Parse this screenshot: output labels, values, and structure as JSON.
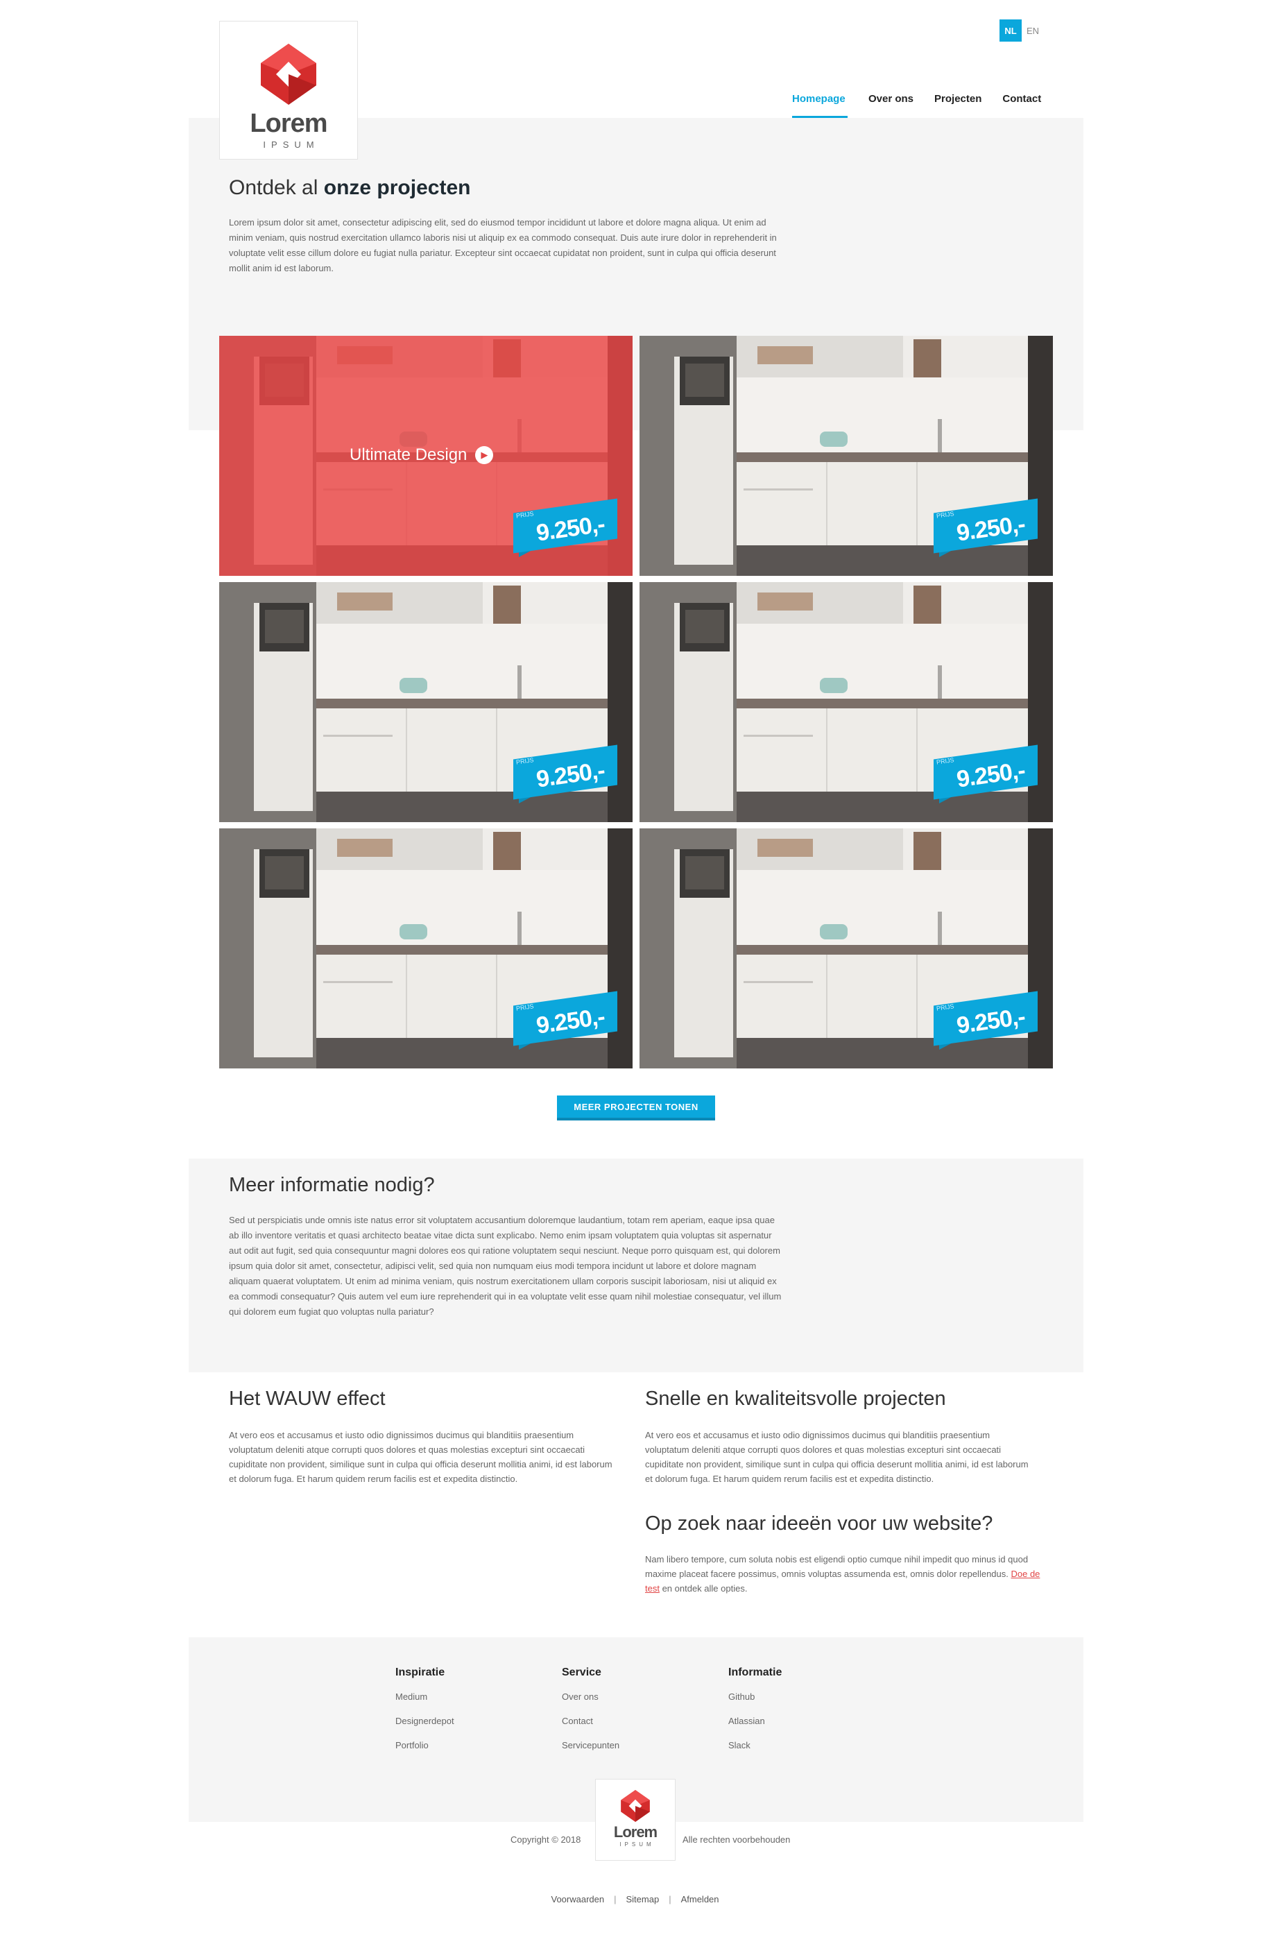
{
  "brand": {
    "name": "Lorem",
    "tagline": "IPSUM",
    "accent": "#0ba7dc",
    "logo_color": "#e53b3b"
  },
  "language": {
    "active": "NL",
    "other": "EN"
  },
  "nav": [
    {
      "label": "Homepage",
      "active": true
    },
    {
      "label": "Over ons",
      "active": false
    },
    {
      "label": "Projecten",
      "active": false
    },
    {
      "label": "Contact",
      "active": false
    }
  ],
  "hero": {
    "title_light": "Ontdek al ",
    "title_bold": "onze projecten",
    "text": "Lorem ipsum dolor sit amet, consectetur adipiscing elit, sed do eiusmod tempor incididunt ut labore et dolore magna aliqua. Ut enim ad minim veniam, quis nostrud exercitation ullamco laboris nisi ut aliquip ex ea commodo consequat. Duis aute irure dolor in reprehenderit in voluptate velit esse cillum dolore eu fugiat nulla pariatur. Excepteur sint occaecat cupidatat non proident, sunt in culpa qui officia deserunt mollit anim id est laborum."
  },
  "projects": {
    "overlay_label": "Ultimate Design",
    "overlay_color": "#ec4646",
    "items": [
      {
        "price_label": "PRIJS",
        "price": "9.250,-"
      },
      {
        "price_label": "PRIJS",
        "price": "9.250,-"
      },
      {
        "price_label": "PRIJS",
        "price": "9.250,-"
      },
      {
        "price_label": "PRIJS",
        "price": "9.250,-"
      },
      {
        "price_label": "PRIJS",
        "price": "9.250,-"
      },
      {
        "price_label": "PRIJS",
        "price": "9.250,-"
      }
    ],
    "more_button": "MEER PROJECTEN TONEN"
  },
  "info": {
    "title": "Meer informatie nodig?",
    "text": "Sed ut perspiciatis unde omnis iste natus error sit voluptatem accusantium doloremque laudantium, totam rem aperiam, eaque ipsa quae ab illo inventore veritatis et quasi architecto beatae vitae dicta sunt explicabo. Nemo enim ipsam voluptatem quia voluptas sit aspernatur aut odit aut fugit, sed quia consequuntur magni dolores eos qui ratione voluptatem sequi nesciunt. Neque porro quisquam est, qui dolorem ipsum quia dolor sit amet, consectetur, adipisci velit, sed quia non numquam eius modi tempora incidunt ut labore et dolore magnam aliquam quaerat voluptatem. Ut enim ad minima veniam, quis nostrum exercitationem ullam corporis suscipit laboriosam, nisi ut aliquid ex ea commodi consequatur? Quis autem vel eum iure reprehenderit qui in ea voluptate velit esse quam nihil molestiae consequatur, vel illum qui dolorem eum fugiat quo voluptas nulla pariatur?"
  },
  "features": {
    "wauw": {
      "title": "Het WAUW effect",
      "text": "At vero eos et accusamus et iusto odio dignissimos ducimus qui blanditiis praesentium voluptatum deleniti atque corrupti quos dolores et quas molestias excepturi sint occaecati cupiditate non provident, similique sunt in culpa qui officia deserunt mollitia animi, id est laborum et dolorum fuga. Et harum quidem rerum facilis est et expedita distinctio."
    },
    "snel": {
      "title": "Snelle en kwaliteitsvolle projecten",
      "text": "At vero eos et accusamus et iusto odio dignissimos ducimus qui blanditiis praesentium voluptatum deleniti atque corrupti quos dolores et quas molestias excepturi sint occaecati cupiditate non provident, similique sunt in culpa qui officia deserunt mollitia animi, id est laborum et dolorum fuga. Et harum quidem rerum facilis est et expedita distinctio."
    },
    "ideeen": {
      "title": "Op zoek naar ideeën voor uw website?",
      "text_before": "Nam libero tempore, cum soluta nobis est eligendi optio cumque nihil impedit quo minus id quod maxime placeat facere possimus, omnis voluptas assumenda est, omnis dolor repellendus. ",
      "link": "Doe de test",
      "text_after": " en ontdek alle opties."
    }
  },
  "footer": {
    "columns": [
      {
        "title": "Inspiratie",
        "links": [
          "Medium",
          "Designerdepot",
          "Portfolio"
        ]
      },
      {
        "title": "Service",
        "links": [
          "Over ons",
          "Contact",
          "Servicepunten"
        ]
      },
      {
        "title": "Informatie",
        "links": [
          "Github",
          "Atlassian",
          "Slack"
        ]
      }
    ],
    "copyright": "Copyright © 2018",
    "rights": "Alle rechten voorbehouden",
    "bottom_links": [
      "Voorwaarden",
      "Sitemap",
      "Afmelden"
    ]
  }
}
